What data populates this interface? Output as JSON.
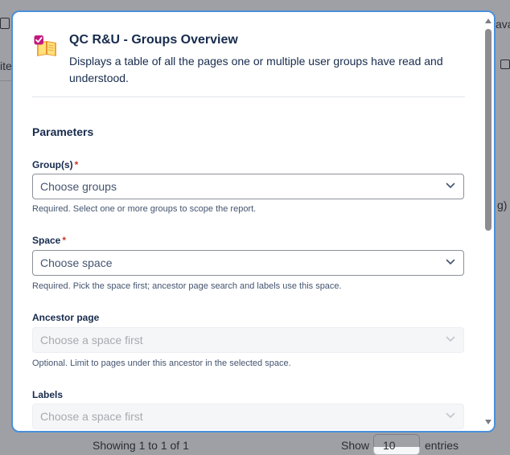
{
  "background": {
    "fragments": {
      "partial_text_right": "ava",
      "partial_text_left": "ite",
      "partial_text_g": "g)",
      "showing": "Showing 1 to 1 of 1",
      "show": "Show",
      "entries": "entries",
      "page_size": "10"
    }
  },
  "modal": {
    "title": "QC R&U - Groups Overview",
    "description": "Displays a table of all the pages one or multiple user groups have read and understood.",
    "section_title": "Parameters",
    "fields": [
      {
        "label": "Group(s)",
        "required": "*",
        "value": "Choose groups",
        "helper": "Required. Select one or more groups to scope the report."
      },
      {
        "label": "Space",
        "required": "*",
        "value": "Choose space",
        "helper": "Required. Pick the space first; ancestor page search and labels use this space."
      },
      {
        "label": "Ancestor page",
        "value": "Choose a space first",
        "helper": "Optional. Limit to pages under this ancestor in the selected space."
      },
      {
        "label": "Labels",
        "value": "Choose a space first"
      }
    ]
  },
  "colors": {
    "accent_border": "#4a8fdb",
    "required": "#c9372c",
    "text": "#172b4d"
  }
}
